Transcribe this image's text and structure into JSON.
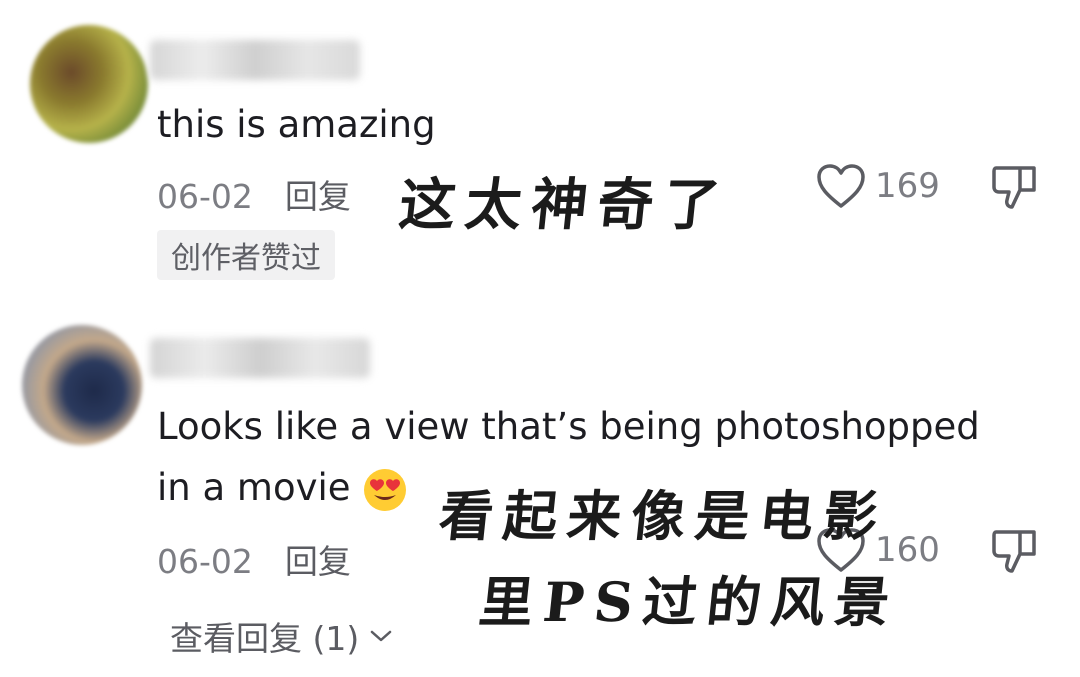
{
  "comments": [
    {
      "text": "this is amazing",
      "date": "06-02",
      "reply_label": "回复",
      "badge": "创作者赞过",
      "like_count": "169",
      "caption": "这太神奇了"
    },
    {
      "text_line1": "Looks like a view that’s being photoshopped",
      "text_line2": "in a movie",
      "date": "06-02",
      "reply_label": "回复",
      "like_count": "160",
      "view_replies": "查看回复 (1)",
      "caption_line1": "看起来像是电影",
      "caption_line2": "里PS过的风景"
    }
  ],
  "icons": {
    "like": "heart-outline-icon",
    "dislike": "thumbs-down-icon",
    "expand": "chevron-down-icon",
    "emoji": "heart-eyes-emoji"
  },
  "colors": {
    "text": "#1d1d22",
    "meta": "#7c7d83",
    "badge_bg": "#f1f1f2"
  }
}
